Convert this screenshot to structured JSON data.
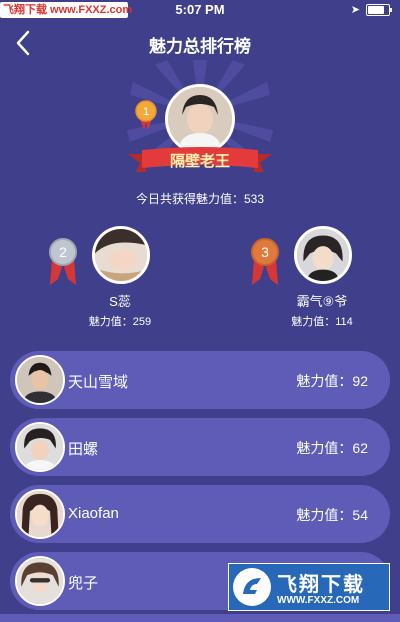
{
  "status_bar": {
    "time": "5:07 PM",
    "battery_level": 0.9
  },
  "watermark_top": {
    "text": "飞翔下载 www.FXXZ.com"
  },
  "header": {
    "title": "魅力总排行榜",
    "back_icon": "chevron-left-icon"
  },
  "champion": {
    "name": "隔壁老王",
    "today_text": "今日共获得魅力值：533"
  },
  "runners_up": [
    {
      "rank": "2",
      "name": "S蕊",
      "value_text": "魅力值：259"
    },
    {
      "rank": "3",
      "name": "霸气⑨爷",
      "value_text": "魅力值：114"
    }
  ],
  "list": [
    {
      "name": "天山雪域",
      "value_text": "魅力值：92"
    },
    {
      "name": "田螺",
      "value_text": "魅力值：62"
    },
    {
      "name": "Xiaofan",
      "value_text": "魅力值：54"
    },
    {
      "name": "兜子",
      "value_text": ""
    }
  ],
  "watermark_bottom": {
    "cn": "飞翔下载",
    "url": "WWW.FXXZ.COM"
  },
  "colors": {
    "background": "#3f3f8c",
    "row": "#5f5cb8",
    "ribbon": "#e33b3b",
    "gold": "#f3a83a",
    "silver": "#bfc6d0",
    "bronze": "#e07a3c"
  }
}
